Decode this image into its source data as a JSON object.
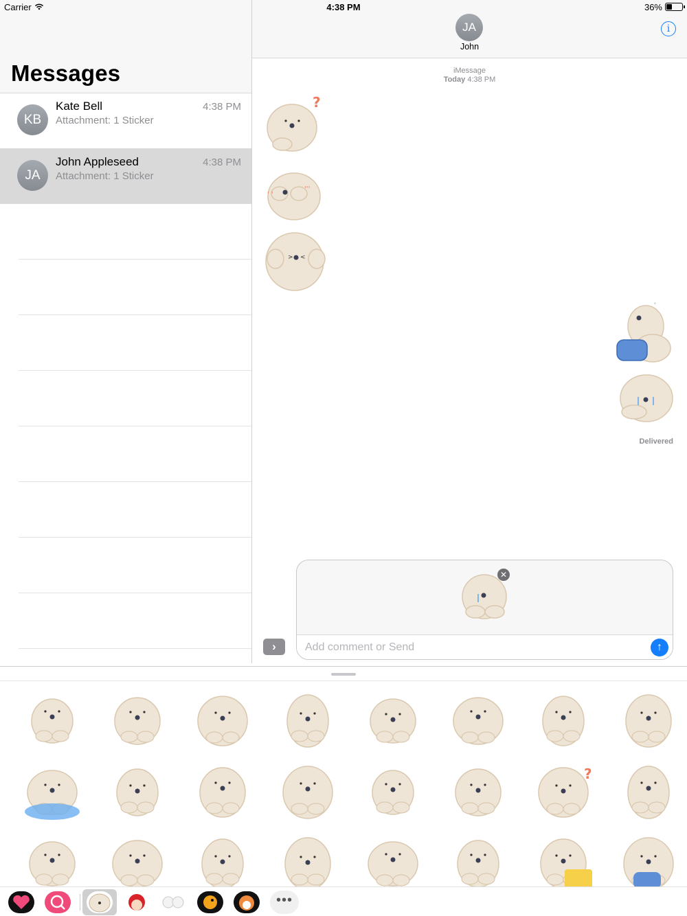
{
  "status_bar": {
    "carrier": "Carrier",
    "time": "4:38 PM",
    "battery": "36%"
  },
  "sidebar": {
    "title": "Messages",
    "conversations": [
      {
        "initials": "KB",
        "name": "Kate Bell",
        "preview": "Attachment: 1 Sticker",
        "time": "4:38 PM",
        "selected": false
      },
      {
        "initials": "JA",
        "name": "John Appleseed",
        "preview": "Attachment: 1 Sticker",
        "time": "4:38 PM",
        "selected": true
      }
    ]
  },
  "conversation": {
    "contact_initials": "JA",
    "contact_name": "John",
    "service": "iMessage",
    "timestamp": "Today 4:38 PM",
    "status": "Delivered",
    "received_stickers": [
      "bear-question",
      "bear-covering-face",
      "bear-hands-on-cheeks"
    ],
    "sent_stickers": [
      "bear-with-blue-pillow",
      "bear-crying"
    ]
  },
  "compose": {
    "placeholder": "Add comment or Send",
    "staged_sticker": "bear-crying"
  },
  "sticker_drawer": {
    "rows": [
      [
        "bear-sitting",
        "bear-thinking",
        "bear-covering-face",
        "bear-holding-letter",
        "bear-angry-mark",
        "bear-standing-hide",
        "bear-hand-chin",
        "bear-peeking"
      ],
      [
        "bear-in-puddle",
        "bear-cheering",
        "bear-lying-down",
        "bear-surprised",
        "bear-peeking-corner",
        "bear-blushing",
        "bear-question",
        "bear-sad"
      ],
      [
        "bear-looking-up",
        "bear-shy",
        "bear-waiting",
        "bear-pouting",
        "bear-happy-arms",
        "bear-hugging",
        "bear-with-cake",
        "bear-with-blue-pillow"
      ]
    ],
    "apps": [
      "heart-app",
      "search-app",
      "bear-app",
      "girl-app",
      "sheep-app",
      "bird-app",
      "hamster-app",
      "more-apps"
    ],
    "more_label": "•••"
  },
  "colors": {
    "accent": "#147efb",
    "bear_fur": "#efe5d6",
    "bear_outline": "#d9c8ae",
    "avatar": "#9a9ea5"
  }
}
